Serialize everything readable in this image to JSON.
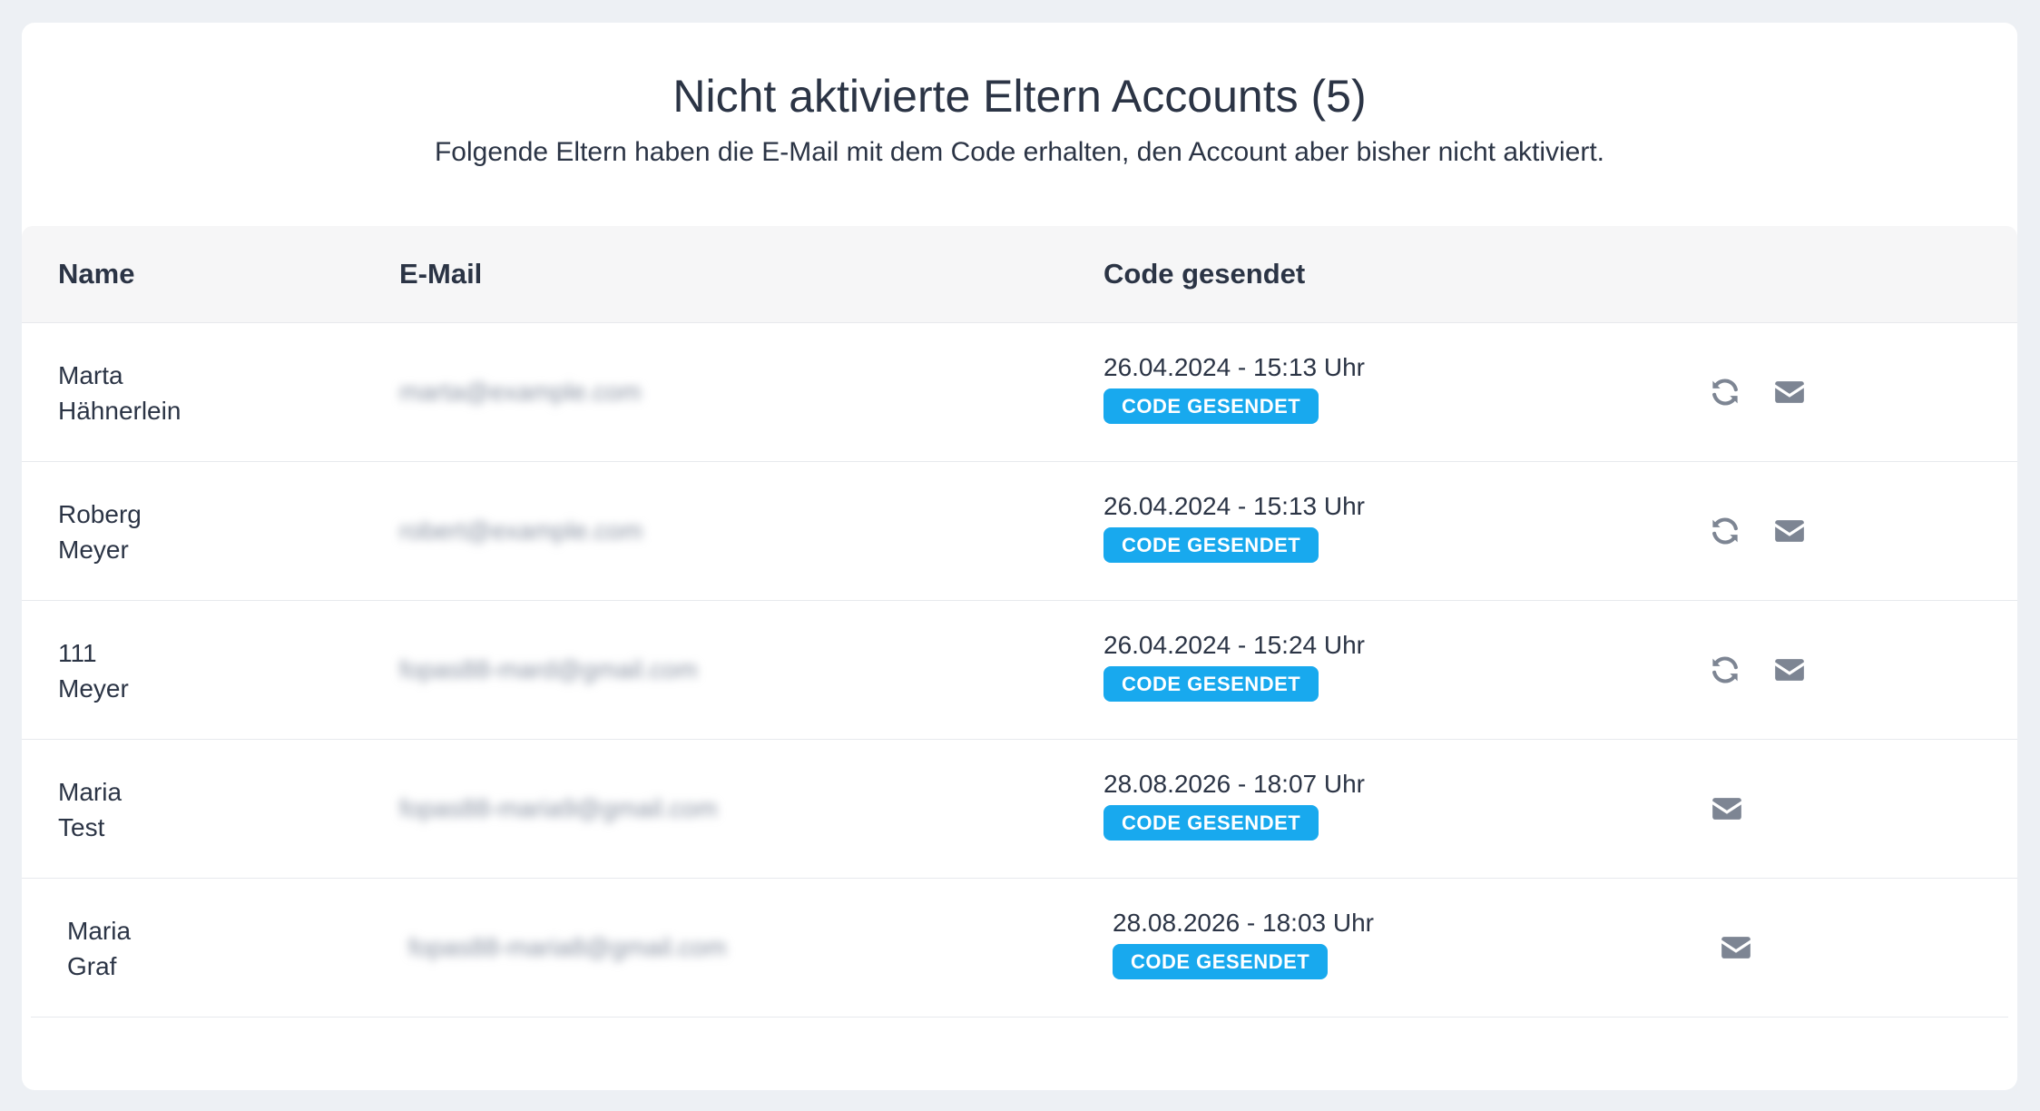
{
  "header": {
    "title": "Nicht aktivierte Eltern Accounts (5)",
    "subtitle": "Folgende Eltern haben die E-Mail mit dem Code erhalten, den Account aber bisher nicht aktiviert."
  },
  "table": {
    "columns": {
      "name": "Name",
      "email": "E-Mail",
      "code_sent": "Code gesendet"
    },
    "rows": [
      {
        "first": "Marta",
        "last": "Hähnerlein",
        "email": "marta@example.com",
        "sent": "26.04.2024 - 15:13 Uhr",
        "badge": "CODE GESENDET",
        "actions": [
          "refresh-icon",
          "envelope-icon"
        ]
      },
      {
        "first": "Roberg",
        "last": "Meyer",
        "email": "robert@example.com",
        "sent": "26.04.2024 - 15:13 Uhr",
        "badge": "CODE GESENDET",
        "actions": [
          "refresh-icon",
          "envelope-icon"
        ]
      },
      {
        "first": "111",
        "last": "Meyer",
        "email": "fopas88-mard@gmail.com",
        "sent": "26.04.2024 - 15:24 Uhr",
        "badge": "CODE GESENDET",
        "actions": [
          "refresh-icon",
          "envelope-icon"
        ]
      },
      {
        "first": "Maria",
        "last": "Test",
        "email": "fopas88-maria9@gmail.com",
        "sent": "28.08.2026 - 18:07 Uhr",
        "badge": "CODE GESENDET",
        "actions": [
          "envelope-icon"
        ]
      },
      {
        "first": "Maria",
        "last": "Graf",
        "email": "fopas88-maria8@gmail.com",
        "sent": "28.08.2026 - 18:03 Uhr",
        "badge": "CODE GESENDET",
        "actions": [
          "envelope-icon"
        ]
      }
    ]
  },
  "colors": {
    "badge": "#18a9ee",
    "icon": "#7d8593",
    "text": "#2b3445",
    "background": "#edf0f4"
  }
}
